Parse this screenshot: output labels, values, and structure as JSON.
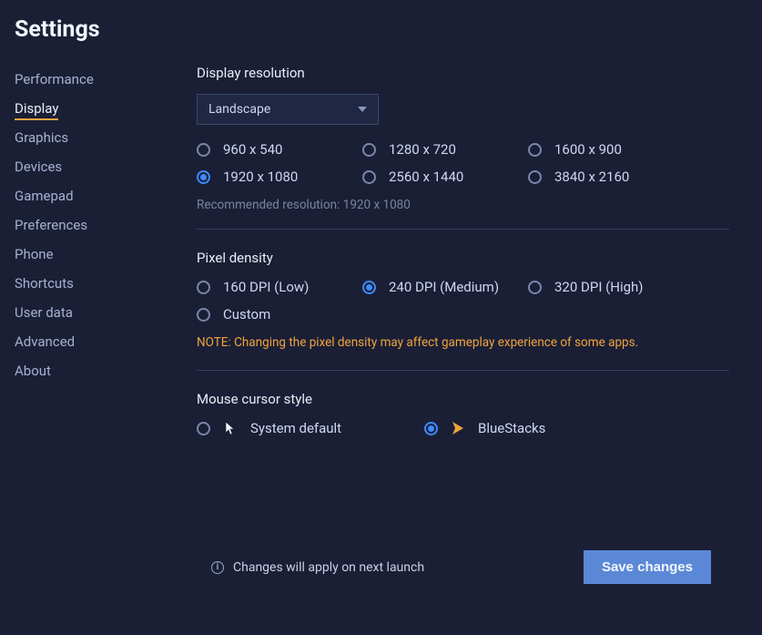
{
  "header": {
    "title": "Settings"
  },
  "sidebar": {
    "items": [
      {
        "label": "Performance"
      },
      {
        "label": "Display"
      },
      {
        "label": "Graphics"
      },
      {
        "label": "Devices"
      },
      {
        "label": "Gamepad"
      },
      {
        "label": "Preferences"
      },
      {
        "label": "Phone"
      },
      {
        "label": "Shortcuts"
      },
      {
        "label": "User data"
      },
      {
        "label": "Advanced"
      },
      {
        "label": "About"
      }
    ],
    "active_index": 1
  },
  "display": {
    "resolution": {
      "title": "Display resolution",
      "orientation_selected": "Landscape",
      "options": [
        {
          "label": "960 x 540"
        },
        {
          "label": "1280 x 720"
        },
        {
          "label": "1600 x 900"
        },
        {
          "label": "1920 x 1080"
        },
        {
          "label": "2560 x 1440"
        },
        {
          "label": "3840 x 2160"
        }
      ],
      "selected_index": 3,
      "recommended_text": "Recommended resolution: 1920 x 1080"
    },
    "pixel_density": {
      "title": "Pixel density",
      "options": [
        {
          "label": "160 DPI (Low)"
        },
        {
          "label": "240 DPI (Medium)"
        },
        {
          "label": "320 DPI (High)"
        },
        {
          "label": "Custom"
        }
      ],
      "selected_index": 1,
      "note": "NOTE: Changing the pixel density may affect gameplay experience of some apps."
    },
    "cursor": {
      "title": "Mouse cursor style",
      "options": [
        {
          "label": "System default"
        },
        {
          "label": "BlueStacks"
        }
      ],
      "selected_index": 1
    }
  },
  "footer": {
    "info_text": "Changes will apply on next launch",
    "save_label": "Save changes"
  }
}
